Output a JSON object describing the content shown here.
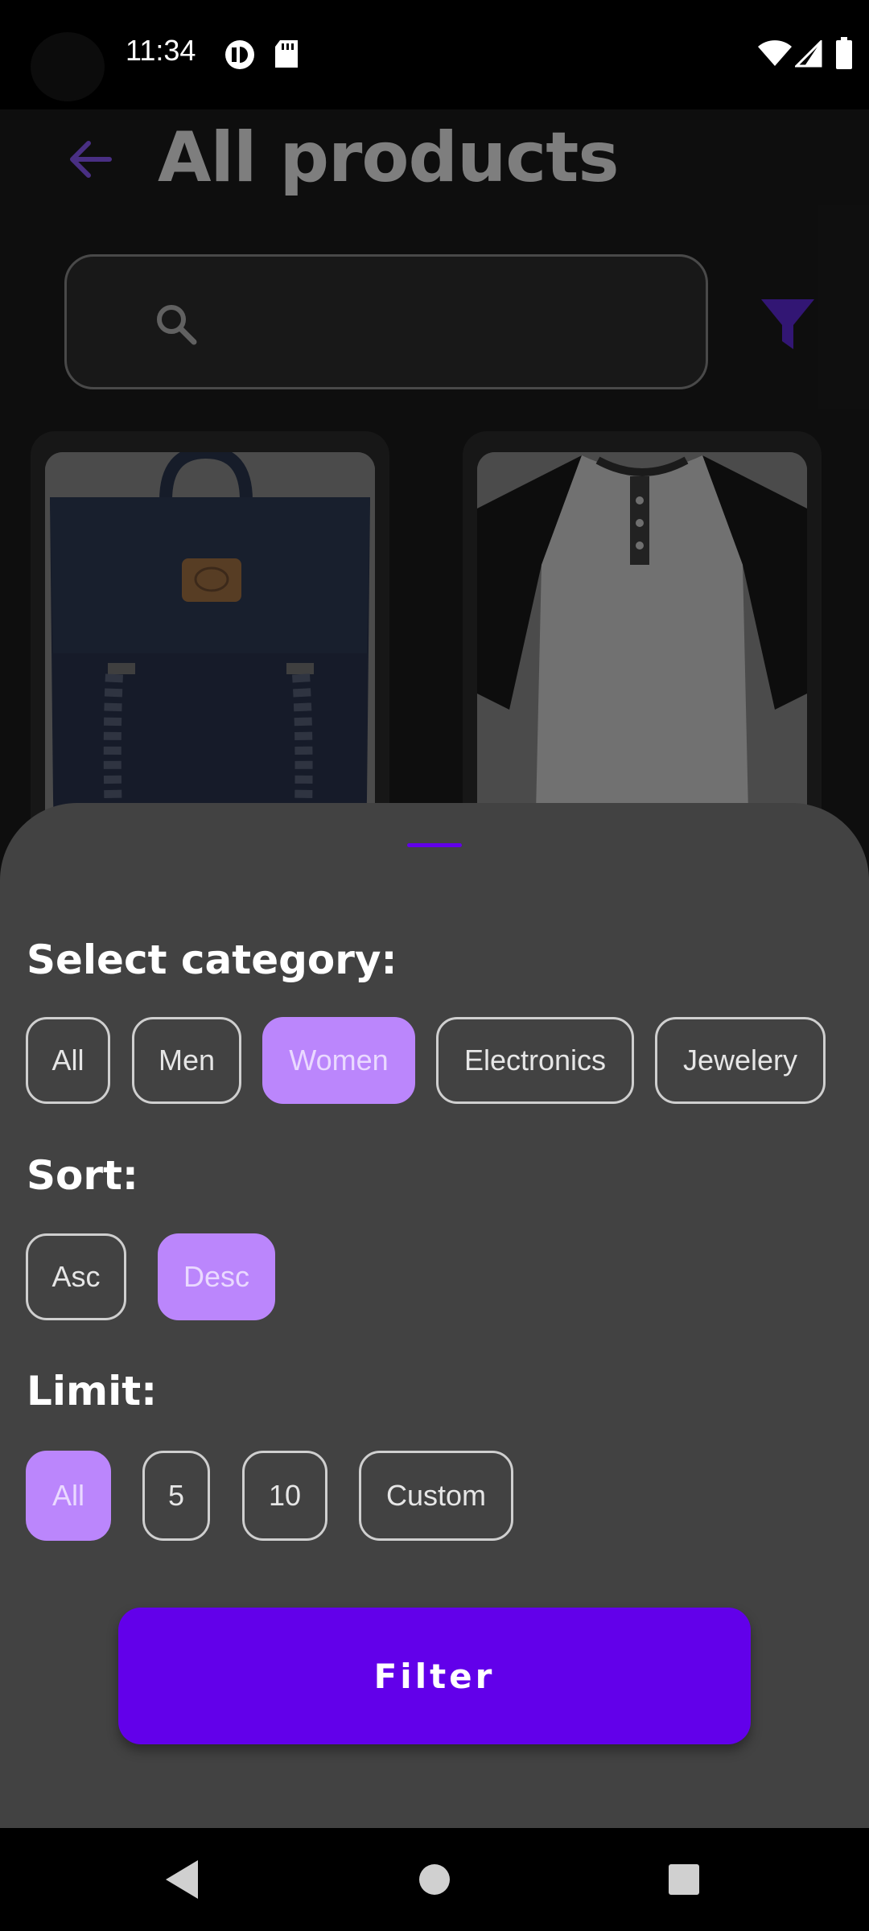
{
  "status_bar": {
    "time": "11:34",
    "icons": [
      "notification-badge-icon",
      "sd-card-icon",
      "wifi-icon",
      "cellular-signal-icon",
      "battery-icon"
    ]
  },
  "header": {
    "title": "All products",
    "back_icon": "arrow-back-icon",
    "filter_icon": "funnel-filter-icon"
  },
  "search": {
    "placeholder": "",
    "value": "",
    "icon": "search-icon"
  },
  "products": [
    {
      "image": "backpack-image"
    },
    {
      "image": "raglan-shirt-image"
    }
  ],
  "filter_sheet": {
    "category": {
      "title": "Select category:",
      "options": [
        "All",
        "Men",
        "Women",
        "Electronics",
        "Jewelery"
      ],
      "selected": "Women"
    },
    "sort": {
      "title": "Sort:",
      "options": [
        "Asc",
        "Desc"
      ],
      "selected": "Desc"
    },
    "limit": {
      "title": "Limit:",
      "options": [
        "All",
        "5",
        "10",
        "Custom"
      ],
      "selected": "All"
    },
    "submit_label": "Filter"
  },
  "colors": {
    "accent": "#6200ea",
    "chip_selected": "#bb86fc",
    "sheet_bg": "#424242"
  },
  "nav_bar": {
    "icons": [
      "back-triangle-icon",
      "home-circle-icon",
      "recents-square-icon"
    ]
  }
}
